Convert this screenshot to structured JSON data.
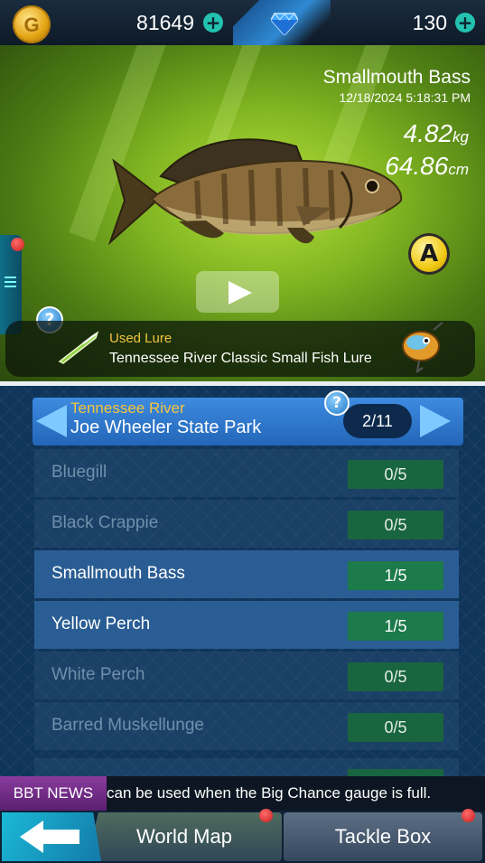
{
  "currency": {
    "coins": "81649",
    "gems": "130",
    "coin_symbol": "G"
  },
  "catch": {
    "species": "Smallmouth Bass",
    "datetime": "12/18/2024 5:18:31 PM",
    "weight_value": "4.82",
    "weight_unit": "kg",
    "length_value": "64.86",
    "length_unit": "cm",
    "grade": "A",
    "lure_label": "Used Lure",
    "lure_name": "Tennessee River Classic Small Fish Lure",
    "help_symbol": "?"
  },
  "location": {
    "region": "Tennessee River",
    "place": "Joe Wheeler State Park",
    "page": "2/11",
    "help_symbol": "?",
    "fish": [
      {
        "name": "Bluegill",
        "count": "0/5"
      },
      {
        "name": "Black Crappie",
        "count": "0/5"
      },
      {
        "name": "Smallmouth Bass",
        "count": "1/5"
      },
      {
        "name": "Yellow Perch",
        "count": "1/5"
      },
      {
        "name": "White Perch",
        "count": "0/5"
      },
      {
        "name": "Barred Muskellunge",
        "count": "0/5"
      }
    ]
  },
  "news": {
    "tag": "BBT NEWS",
    "text": "can be used when the Big Chance gauge is full."
  },
  "nav": {
    "world_map": "World Map",
    "tackle_box": "Tackle Box"
  },
  "colors": {
    "accent_gold": "#f5c53e",
    "count_green": "#1d7a4a",
    "header_blue": "#2f78cc"
  }
}
